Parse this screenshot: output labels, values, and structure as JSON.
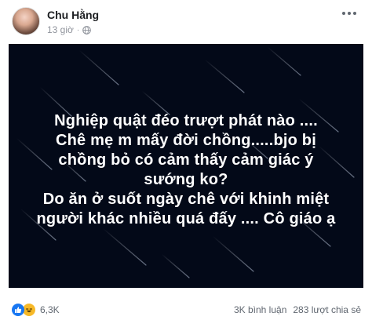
{
  "post": {
    "author_name": "Chu Hằng",
    "time_label": "13 giờ",
    "separator": "·",
    "status_lines": [
      "Nghiệp quật đéo trượt phát nào ....",
      "Chê mẹ m mấy đời chồng.....bjo bị",
      "chồng bỏ có cảm thấy cảm giác ý",
      "sướng ko?",
      "Do ăn ở suốt ngày chê với khinh miệt",
      "người khác nhiều quá đấy .... Cô giáo ạ"
    ]
  },
  "footer": {
    "reaction_count": "6,3K",
    "comments_label": "3K bình luận",
    "shares_label": "283 lượt chia sẻ"
  },
  "icons": {
    "privacy": "globe-icon",
    "menu": "more-options-icon",
    "reaction_1": "like-icon",
    "reaction_2": "haha-icon"
  },
  "colors": {
    "status_background": "#030918",
    "like_blue": "#1877f2",
    "haha_yellow": "#f7b928"
  }
}
